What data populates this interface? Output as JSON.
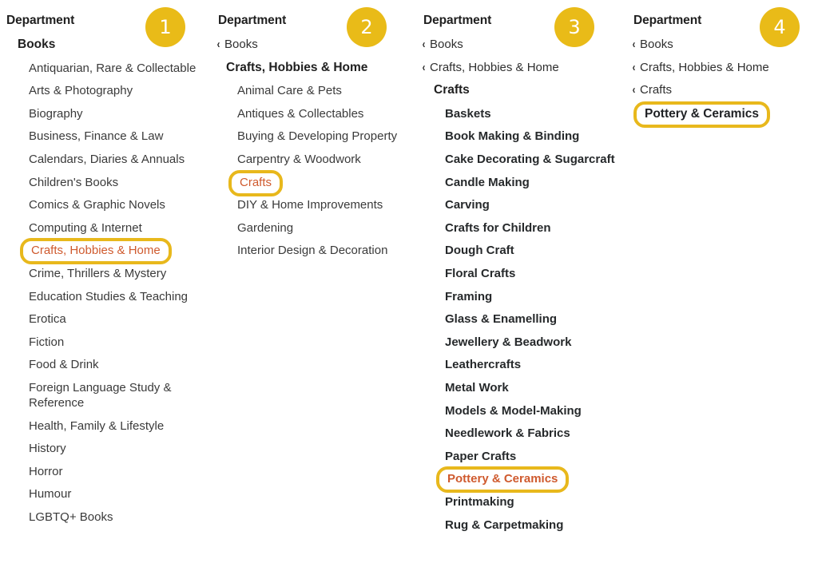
{
  "meta": {
    "accent_gold": "#e8b81c",
    "badge_bg": "#e9bb18",
    "highlight_text": "#cf5a2e",
    "text_color": "#3a3a3a"
  },
  "header_label": "Department",
  "chevron_glyph": "‹",
  "panels": [
    {
      "badge": "1",
      "title": "Department",
      "breadcrumbs": [],
      "node": "Books",
      "items": [
        {
          "label": "Antiquarian, Rare & Collectable",
          "highlighted": false
        },
        {
          "label": "Arts & Photography",
          "highlighted": false
        },
        {
          "label": "Biography",
          "highlighted": false
        },
        {
          "label": "Business, Finance & Law",
          "highlighted": false
        },
        {
          "label": "Calendars, Diaries & Annuals",
          "highlighted": false
        },
        {
          "label": "Children's Books",
          "highlighted": false
        },
        {
          "label": "Comics & Graphic Novels",
          "highlighted": false
        },
        {
          "label": "Computing & Internet",
          "highlighted": false
        },
        {
          "label": "Crafts, Hobbies & Home",
          "highlighted": true
        },
        {
          "label": "Crime, Thrillers & Mystery",
          "highlighted": false
        },
        {
          "label": "Education Studies & Teaching",
          "highlighted": false
        },
        {
          "label": "Erotica",
          "highlighted": false
        },
        {
          "label": "Fiction",
          "highlighted": false
        },
        {
          "label": "Food & Drink",
          "highlighted": false
        },
        {
          "label": "Foreign Language Study & Reference",
          "highlighted": false
        },
        {
          "label": "Health, Family & Lifestyle",
          "highlighted": false
        },
        {
          "label": "History",
          "highlighted": false
        },
        {
          "label": "Horror",
          "highlighted": false
        },
        {
          "label": "Humour",
          "highlighted": false
        },
        {
          "label": "LGBTQ+ Books",
          "highlighted": false
        }
      ]
    },
    {
      "badge": "2",
      "title": "Department",
      "breadcrumbs": [
        "Books"
      ],
      "node": "Crafts, Hobbies & Home",
      "items": [
        {
          "label": "Animal Care & Pets",
          "highlighted": false
        },
        {
          "label": "Antiques & Collectables",
          "highlighted": false
        },
        {
          "label": "Buying & Developing Property",
          "highlighted": false
        },
        {
          "label": "Carpentry & Woodwork",
          "highlighted": false
        },
        {
          "label": "Crafts",
          "highlighted": true
        },
        {
          "label": "DIY & Home Improvements",
          "highlighted": false
        },
        {
          "label": "Gardening",
          "highlighted": false
        },
        {
          "label": "Interior Design & Decoration",
          "highlighted": false
        }
      ]
    },
    {
      "badge": "3",
      "title": "Department",
      "breadcrumbs": [
        "Books",
        "Crafts, Hobbies & Home"
      ],
      "node": "Crafts",
      "items": [
        {
          "label": "Baskets",
          "highlighted": false
        },
        {
          "label": "Book Making & Binding",
          "highlighted": false
        },
        {
          "label": "Cake Decorating & Sugarcraft",
          "highlighted": false
        },
        {
          "label": "Candle Making",
          "highlighted": false
        },
        {
          "label": "Carving",
          "highlighted": false
        },
        {
          "label": "Crafts for Children",
          "highlighted": false
        },
        {
          "label": "Dough Craft",
          "highlighted": false
        },
        {
          "label": "Floral Crafts",
          "highlighted": false
        },
        {
          "label": "Framing",
          "highlighted": false
        },
        {
          "label": "Glass & Enamelling",
          "highlighted": false
        },
        {
          "label": "Jewellery & Beadwork",
          "highlighted": false
        },
        {
          "label": "Leathercrafts",
          "highlighted": false
        },
        {
          "label": "Metal Work",
          "highlighted": false
        },
        {
          "label": "Models & Model-Making",
          "highlighted": false
        },
        {
          "label": "Needlework & Fabrics",
          "highlighted": false
        },
        {
          "label": "Paper Crafts",
          "highlighted": false
        },
        {
          "label": "Pottery & Ceramics",
          "highlighted": true
        },
        {
          "label": "Printmaking",
          "highlighted": false
        },
        {
          "label": "Rug & Carpetmaking",
          "highlighted": false
        }
      ]
    },
    {
      "badge": "4",
      "title": "Department",
      "breadcrumbs": [
        "Books",
        "Crafts, Hobbies & Home",
        "Crafts"
      ],
      "node": "Pottery & Ceramics",
      "node_highlighted": true,
      "items": []
    }
  ]
}
